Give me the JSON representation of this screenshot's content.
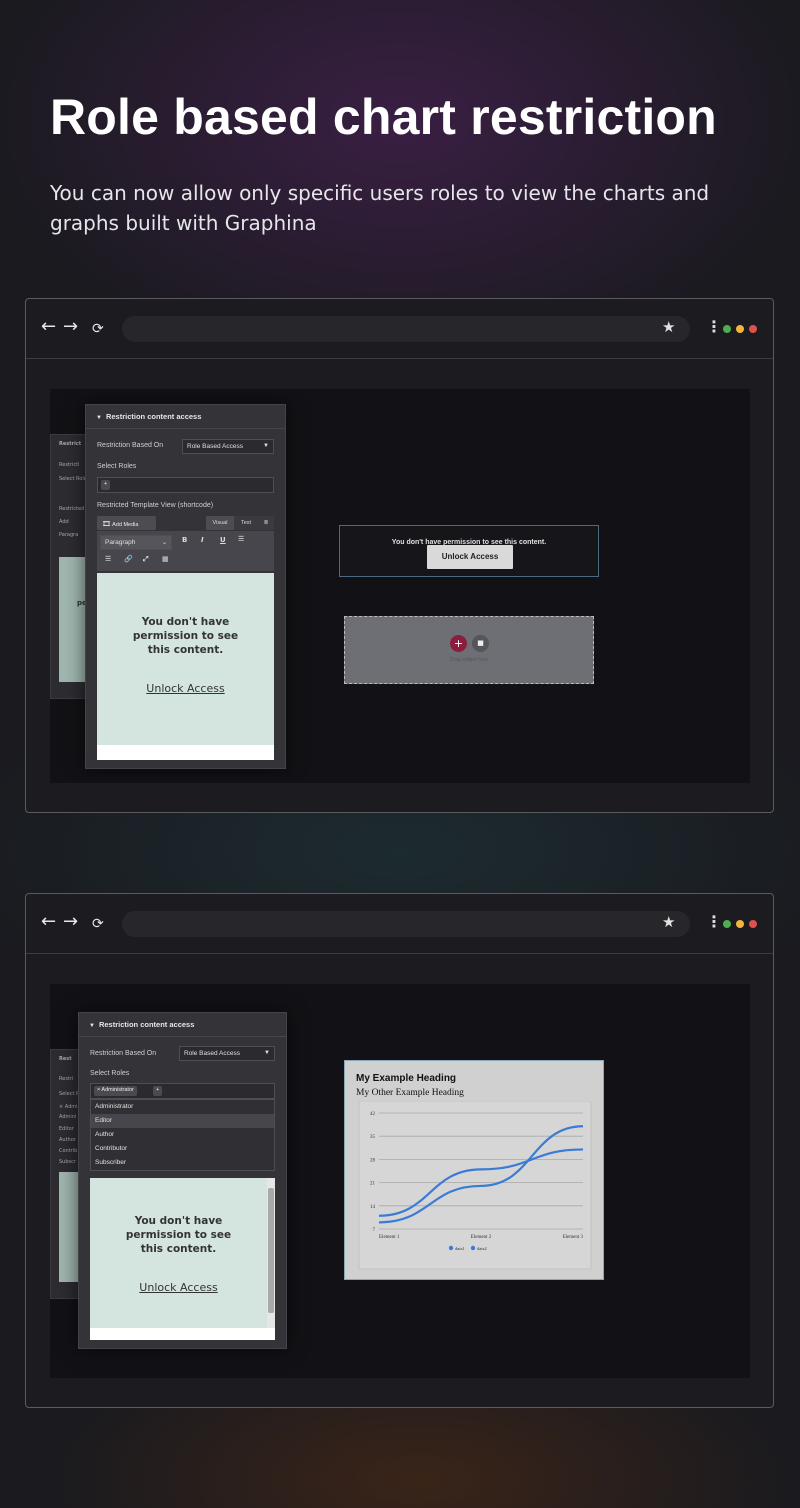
{
  "hero": {
    "title": "Role based chart restriction",
    "subtitle": "You can now allow only specific users roles to  view the charts and graphs built with Graphina"
  },
  "browser": {
    "back_icon": "←",
    "forward_icon": "→",
    "reload_icon": "⟳",
    "star_icon": "★",
    "menu_icon": "⋮",
    "dots": [
      "#4caf50",
      "#f4b63a",
      "#e0504f"
    ]
  },
  "panel": {
    "title": "Restriction content access",
    "restriction_label": "Restriction Based On",
    "restriction_value": "Role Based Access",
    "roles_label": "Select Roles",
    "add_tag": "+",
    "template_label": "Restricted Template View (shortcode)",
    "add_media": "Add Media",
    "tab_visual": "Visual",
    "tab_text": "Text",
    "format_value": "Paragraph",
    "content_message": "You don't have permission to see this content.",
    "content_link": "Unlock Access"
  },
  "ghost": {
    "heading": "Restrict",
    "line1": "Restricti",
    "line2": "Select Roles",
    "line3": "Restricted",
    "line4": "Add",
    "line5": "Paragra",
    "frag": "pe"
  },
  "preview1": {
    "notice_text": "You don't have permission to see this content.",
    "notice_button": "Unlock Access",
    "drop_text": "Drag widget here"
  },
  "panel2": {
    "selected_tag": "× Administrator",
    "role_options": [
      "Administrator",
      "Editor",
      "Author",
      "Contributor",
      "Subscriber"
    ],
    "highlighted_option": "Editor"
  },
  "ghost2": {
    "heading": "Rest",
    "line1": "Restri",
    "line2": "Select R",
    "line3": "× Admi",
    "items": [
      "Admini",
      "Editor",
      "Author",
      "Contrib",
      "Subscr"
    ]
  },
  "chart_data": {
    "type": "line",
    "title": "My Example Heading",
    "subtitle": "My Other Example Heading",
    "categories": [
      "Element 1",
      "Element 2",
      "Element 3"
    ],
    "yticks": [
      7,
      14,
      21,
      28,
      35,
      42
    ],
    "ylim": [
      7,
      42
    ],
    "series": [
      {
        "name": "data1",
        "values": [
          9,
          20,
          38
        ],
        "color": "#3a7bd5"
      },
      {
        "name": "data2",
        "values": [
          11,
          25,
          31
        ],
        "color": "#3a7bd5"
      }
    ],
    "grid": true,
    "legend": "bottom"
  }
}
